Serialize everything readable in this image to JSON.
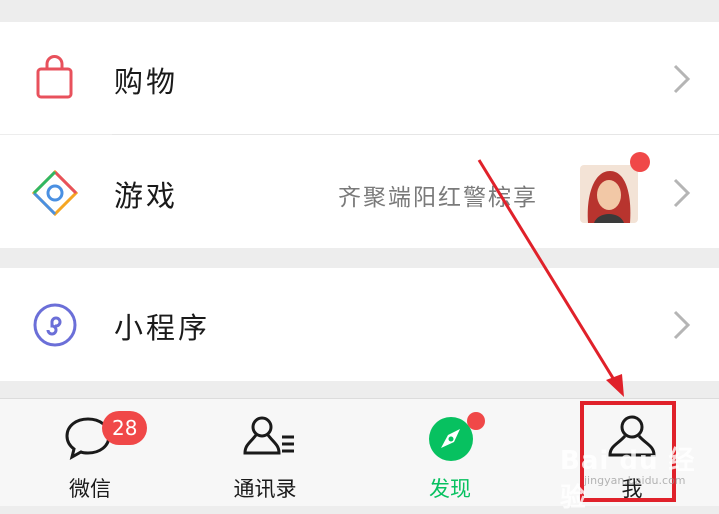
{
  "menu": {
    "shopping": {
      "label": "购物",
      "icon": "shopping-bag-icon"
    },
    "games": {
      "label": "游戏",
      "subtext": "齐聚端阳红警棕享",
      "icon": "games-icon"
    },
    "mini_programs": {
      "label": "小程序",
      "icon": "mini-program-icon"
    }
  },
  "tabbar": {
    "chats": {
      "label": "微信",
      "badge": "28",
      "icon": "chat-bubble-icon"
    },
    "contacts": {
      "label": "通讯录",
      "icon": "contacts-icon"
    },
    "discover": {
      "label": "发现",
      "icon": "compass-icon"
    },
    "me": {
      "label": "我",
      "icon": "person-icon"
    }
  },
  "watermark": {
    "text": "Bai du 经验",
    "sub": "jingyan.baidu.com"
  },
  "colors": {
    "accent_green": "#07c160",
    "badge_red": "#f04848",
    "annotation_red": "#e0212a"
  }
}
